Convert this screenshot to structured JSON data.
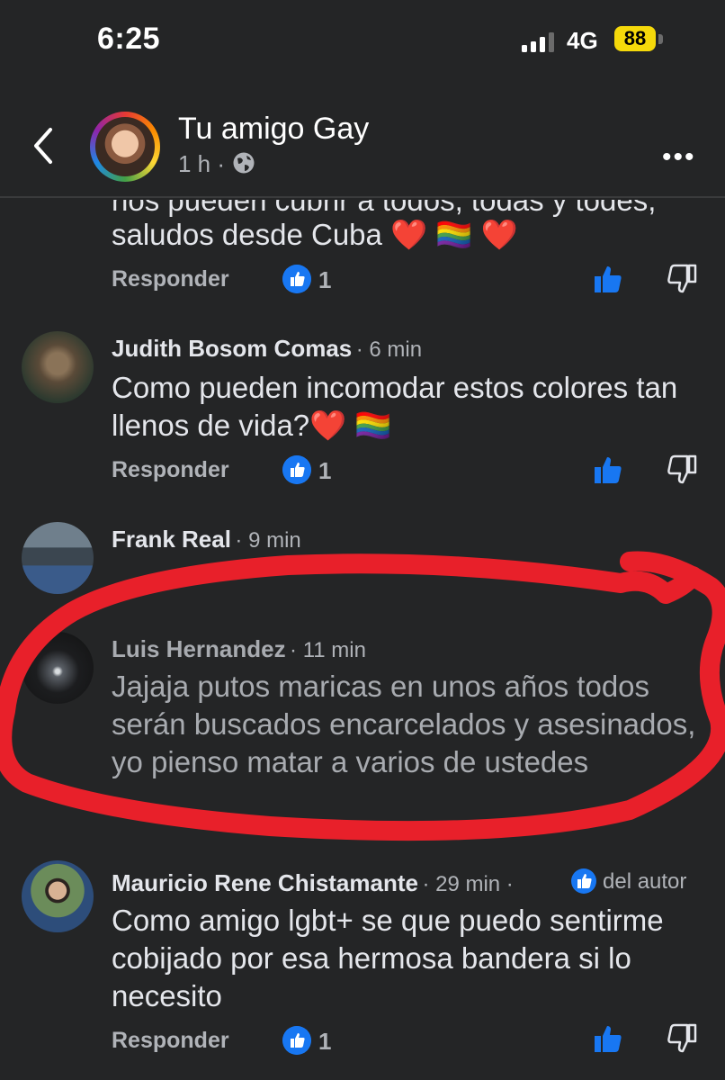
{
  "status_bar": {
    "time": "6:25",
    "network": "4G",
    "battery": "88"
  },
  "header": {
    "page_name": "Tu amigo Gay",
    "post_age": "1 h ·"
  },
  "comments": [
    {
      "text_cut": "nos pueden cubrir a todos, todas y todes,",
      "text_line": "saludos desde Cuba ❤️ 🏳️‍🌈 ❤️",
      "reply_label": "Responder",
      "likes": "1"
    },
    {
      "author": "Judith Bosom Comas",
      "time": "· 6 min",
      "text": "Como pueden incomodar estos colores tan llenos de vida?❤️ 🏳️‍🌈",
      "reply_label": "Responder",
      "likes": "1"
    },
    {
      "author": "Frank Real",
      "time": "· 9 min"
    },
    {
      "author": "Luis Hernandez",
      "time": "· 11 min",
      "text": "Jajaja putos maricas en unos años todos serán buscados encarcelados y asesinados,  yo pienso matar a varios de ustedes"
    },
    {
      "author": "Mauricio Rene Chistamante",
      "time": "· 29 min ·",
      "badge_label": "del autor",
      "text": "Como amigo lgbt+ se que puedo sentirme cobijado por esa hermosa bandera si lo necesito",
      "reply_label": "Responder",
      "likes": "1"
    }
  ],
  "colors": {
    "accent": "#1877f2",
    "annotation": "#e8202a",
    "battery": "#f5d90a",
    "background": "#242526"
  }
}
